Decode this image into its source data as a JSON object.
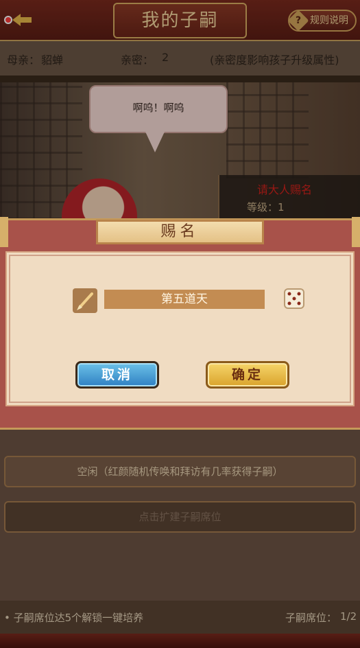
{
  "header": {
    "title": "我的子嗣",
    "rules_label": "规则说明",
    "rules_icon": "?"
  },
  "info": {
    "mother_label": "母亲：",
    "mother_name": "貂蝉",
    "intimacy_label": "亲密：",
    "intimacy_value": "2",
    "note": "(亲密度影响孩子升级属性)"
  },
  "scene": {
    "speech": "啊呜！啊呜",
    "name_prompt": "请大人赐名",
    "level_label": "等级：",
    "level_value": "1"
  },
  "modal": {
    "title": "赐名",
    "name_value": "第五道天",
    "cancel_label": "取消",
    "confirm_label": "确定"
  },
  "list": {
    "rows": [
      {
        "label": "空闲（红颜随机传唤和拜访有几率获得子嗣）"
      },
      {
        "label": "点击扩建子嗣席位"
      }
    ]
  },
  "footer": {
    "unlock_text": "• 子嗣席位达5个解锁一键培养",
    "seats_label": "子嗣席位：",
    "seats_value": "1/2"
  },
  "colors": {
    "accent_red": "#d2221c",
    "cancel_blue": "#2f7fc2",
    "confirm_gold": "#d9a32c"
  }
}
